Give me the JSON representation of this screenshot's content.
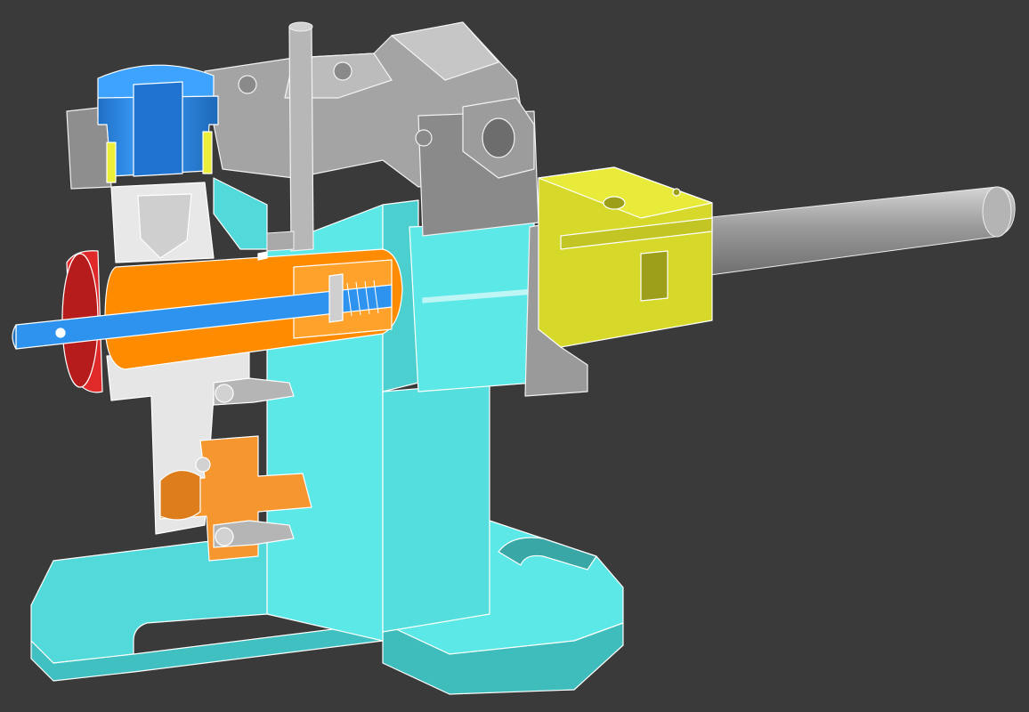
{
  "scene": {
    "background": "#3a3a3a",
    "parts": [
      {
        "name": "base-block",
        "color": "#5de8e8"
      },
      {
        "name": "upper-housing",
        "color": "#9a9a9a"
      },
      {
        "name": "top-cylinder",
        "color": "#2e93ef"
      },
      {
        "name": "guide-sleeve",
        "color": "#ff8c00"
      },
      {
        "name": "plunger-rod",
        "color": "#2e93ef"
      },
      {
        "name": "front-collar",
        "color": "#e02a2a"
      },
      {
        "name": "clamp-yoke",
        "color": "#d6d92a"
      },
      {
        "name": "output-shaft",
        "color": "#8a8a8a"
      },
      {
        "name": "lower-clamp",
        "color": "#f5962e"
      },
      {
        "name": "bracket",
        "color": "#e4e4e4"
      }
    ]
  }
}
